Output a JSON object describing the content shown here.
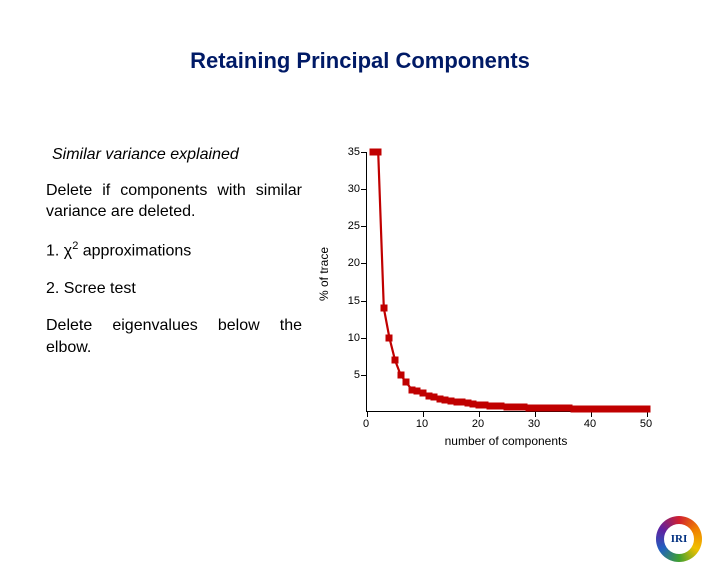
{
  "title": "Retaining Principal Components",
  "left": {
    "subtitle": "Similar variance explained",
    "para1": "Delete if components with similar variance are deleted.",
    "item1_prefix": "1. χ",
    "item1_sup": "2",
    "item1_suffix": " approximations",
    "item2": "2. Scree test",
    "para2": "Delete eigenvalues below the elbow."
  },
  "logo_text": "IRI",
  "chart_data": {
    "type": "line",
    "xlabel": "number of components",
    "ylabel": "% of trace",
    "xlim": [
      0,
      50
    ],
    "ylim": [
      0,
      35
    ],
    "xticks": [
      0,
      10,
      20,
      30,
      40,
      50
    ],
    "yticks": [
      5,
      10,
      15,
      20,
      25,
      30,
      35
    ],
    "series": [
      {
        "name": "trace",
        "color": "#c00000",
        "x": [
          1,
          2,
          3,
          4,
          5,
          6,
          7,
          8,
          9,
          10,
          11,
          12,
          13,
          14,
          15,
          16,
          17,
          18,
          19,
          20,
          21,
          22,
          23,
          24,
          25,
          26,
          27,
          28,
          29,
          30,
          31,
          32,
          33,
          34,
          35,
          36,
          37,
          38,
          39,
          40,
          41,
          42,
          43,
          44,
          45,
          46,
          47,
          48,
          49,
          50
        ],
        "y": [
          35,
          35,
          14,
          10,
          7,
          5,
          4,
          3,
          2.8,
          2.5,
          2.2,
          2.0,
          1.8,
          1.6,
          1.5,
          1.4,
          1.3,
          1.2,
          1.1,
          1.0,
          0.9,
          0.85,
          0.8,
          0.75,
          0.7,
          0.68,
          0.65,
          0.62,
          0.6,
          0.58,
          0.56,
          0.54,
          0.52,
          0.5,
          0.49,
          0.48,
          0.47,
          0.46,
          0.45,
          0.44,
          0.43,
          0.42,
          0.41,
          0.4,
          0.4,
          0.4,
          0.4,
          0.4,
          0.4,
          0.4
        ]
      }
    ]
  }
}
